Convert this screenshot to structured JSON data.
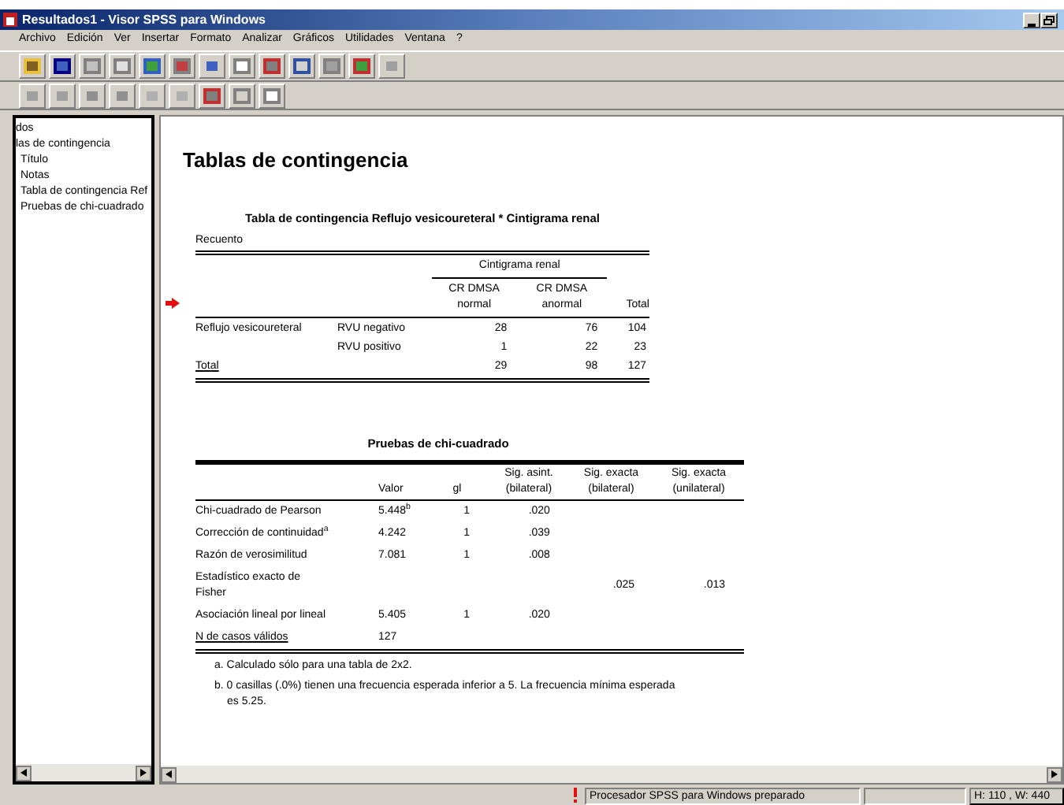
{
  "window": {
    "title": "Resultados1 - Visor SPSS para Windows"
  },
  "menu": [
    "Archivo",
    "Edición",
    "Ver",
    "Insertar",
    "Formato",
    "Analizar",
    "Gráficos",
    "Utilidades",
    "Ventana",
    "?"
  ],
  "outline": [
    {
      "label": "dos",
      "children": [
        {
          "label": "las de contingencia",
          "children": [
            {
              "label": "Título"
            },
            {
              "label": "Notas"
            },
            {
              "label": "Tabla de contingencia Ref"
            },
            {
              "label": "Pruebas de chi-cuadrado"
            }
          ]
        }
      ]
    }
  ],
  "heading": "Tablas de contingencia",
  "crosstab": {
    "title": "Tabla de contingencia Reflujo vesicoureteral * Cintigrama renal",
    "subtitle": "Recuento",
    "group_header": "Cintigrama renal",
    "columns": [
      "CR DMSA normal",
      "CR DMSA anormal",
      "Total"
    ],
    "rows": [
      {
        "label": "Reflujo vesicoureteral",
        "sublabel": "RVU negativo",
        "values": [
          "28",
          "76",
          "104"
        ]
      },
      {
        "sublabel": "RVU positivo",
        "values": [
          "1",
          "22",
          "23"
        ]
      },
      {
        "label": "Total",
        "values": [
          "29",
          "98",
          "127"
        ]
      }
    ]
  },
  "chi": {
    "title": "Pruebas de chi-cuadrado",
    "columns": [
      "Valor",
      "gl",
      "Sig. asint. (bilateral)",
      "Sig. exacta (bilateral)",
      "Sig. exacta (unilateral)"
    ],
    "rows": [
      {
        "label": "Chi-cuadrado de Pearson",
        "values": {
          "valor": "5.448$^{b}$",
          "gl": "1",
          "sig_asint": ".020"
        }
      },
      {
        "label": "Corrección de continuidad$^{a}$",
        "values": {
          "valor": "4.242",
          "gl": "1",
          "sig_asint": ".039"
        }
      },
      {
        "label": "Razón de verosimilitud",
        "values": {
          "valor": "7.081",
          "gl": "1",
          "sig_asint": ".008"
        }
      },
      {
        "label": "Estadístico exacto de Fisher",
        "values": {
          "sig_exacta_bilateral": ".025",
          "sig_exacta_unilateral": ".013"
        }
      },
      {
        "label": "Asociación lineal por lineal",
        "values": {
          "valor": "5.405",
          "gl": "1",
          "sig_asint": ".020"
        }
      },
      {
        "label": "N de casos válidos",
        "values": {
          "valor": "127"
        }
      }
    ],
    "footnotes": [
      "a. Calculado sólo para una tabla de 2x2.",
      "b. 0 casillas (.0%) tienen una frecuencia esperada inferior a 5. La frecuencia mínima esperada es 5.25."
    ]
  },
  "status_bar": {
    "message": "Procesador SPSS para Windows preparado",
    "size": "H: 110 , W: 440"
  }
}
